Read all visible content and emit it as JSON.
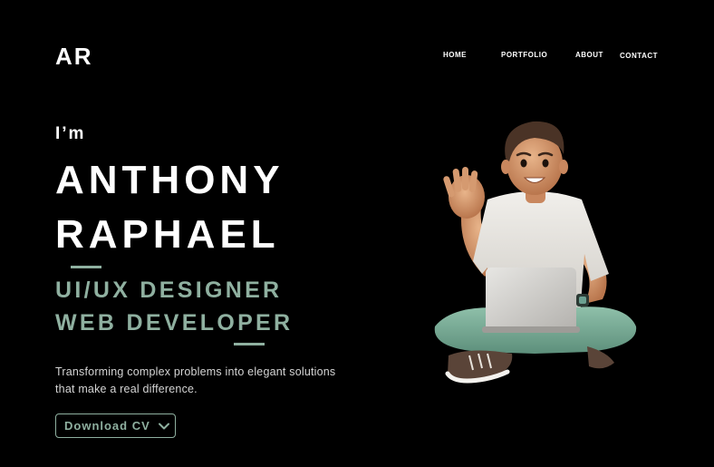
{
  "header": {
    "logo": "AR",
    "nav": [
      "HOME",
      "PORTFOLIO",
      "ABOUT",
      "CONTACT"
    ]
  },
  "hero": {
    "greeting": "I’m",
    "name_line1": "ANTHONY",
    "name_line2": "RAPHAEL",
    "role_line1": "UI/UX DESIGNER",
    "role_line2": "WEB DEVELOPER",
    "tagline_line1": "Transforming complex problems into elegant solutions",
    "tagline_line2": "that make a real difference.",
    "cta_label": "Download CV",
    "cta_icon": "chevron-down-icon",
    "illustration": "avatar-illustration"
  },
  "colors": {
    "background": "#000000",
    "text": "#ffffff",
    "accent": "#8fb0a0"
  }
}
